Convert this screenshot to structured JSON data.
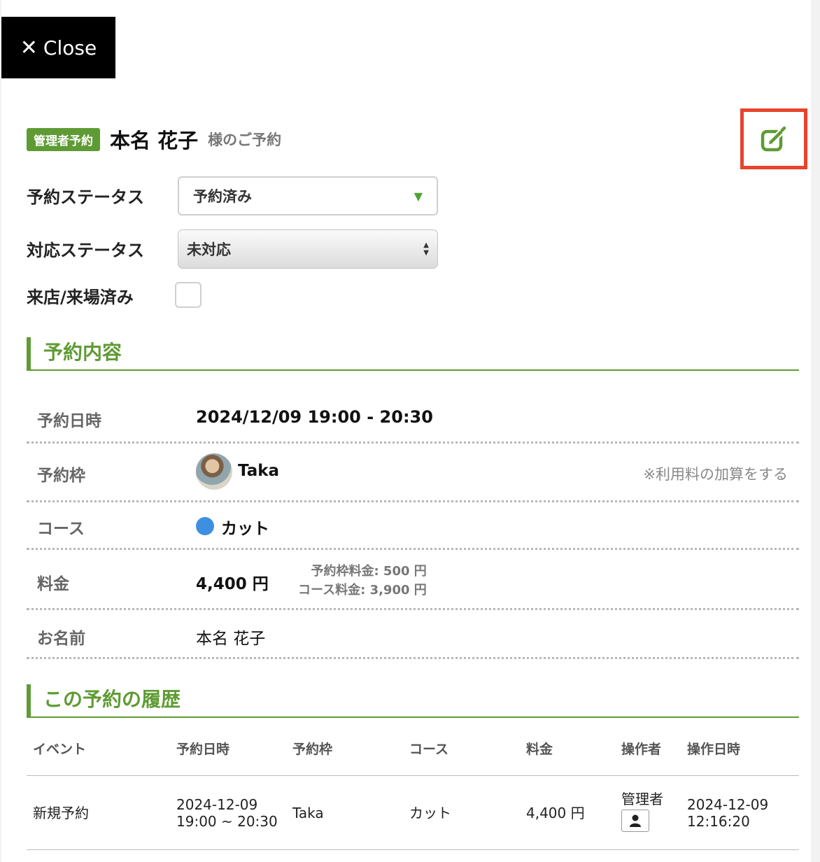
{
  "close_button": {
    "label": "Close",
    "icon": "close-icon"
  },
  "header": {
    "badge": "管理者予約",
    "customer_name": "本名 花子",
    "suffix": "様のご予約",
    "edit_icon": "edit-icon",
    "accent_color": "#5f9b34",
    "highlight_color": "#e8432b"
  },
  "form": {
    "reservation_status": {
      "label": "予約ステータス",
      "value": "予約済み"
    },
    "response_status": {
      "label": "対応ステータス",
      "value": "未対応"
    },
    "visited": {
      "label": "来店/来場済み",
      "checked": false
    }
  },
  "details": {
    "title": "予約内容",
    "datetime": {
      "label": "予約日時",
      "value": "2024/12/09 19:00 - 20:30"
    },
    "slot": {
      "label": "予約枠",
      "value": "Taka",
      "note": "※利用料の加算をする"
    },
    "course": {
      "label": "コース",
      "value": "カット",
      "dot_color": "#3d8fe0"
    },
    "price": {
      "label": "料金",
      "value": "4,400 円",
      "slot_fee": "予約枠料金: 500 円",
      "course_fee": "コース料金: 3,900 円"
    },
    "name": {
      "label": "お名前",
      "value": "本名 花子"
    }
  },
  "history": {
    "title": "この予約の履歴",
    "columns": [
      "イベント",
      "予約日時",
      "予約枠",
      "コース",
      "料金",
      "操作者",
      "操作日時"
    ],
    "rows": [
      {
        "event": "新規予約",
        "date_line1": "2024-12-09",
        "date_line2": "19:00 ~ 20:30",
        "slot": "Taka",
        "course": "カット",
        "price": "4,400 円",
        "operator": "管理者",
        "op_date_line1": "2024-12-09",
        "op_date_line2": "12:16:20"
      }
    ]
  }
}
